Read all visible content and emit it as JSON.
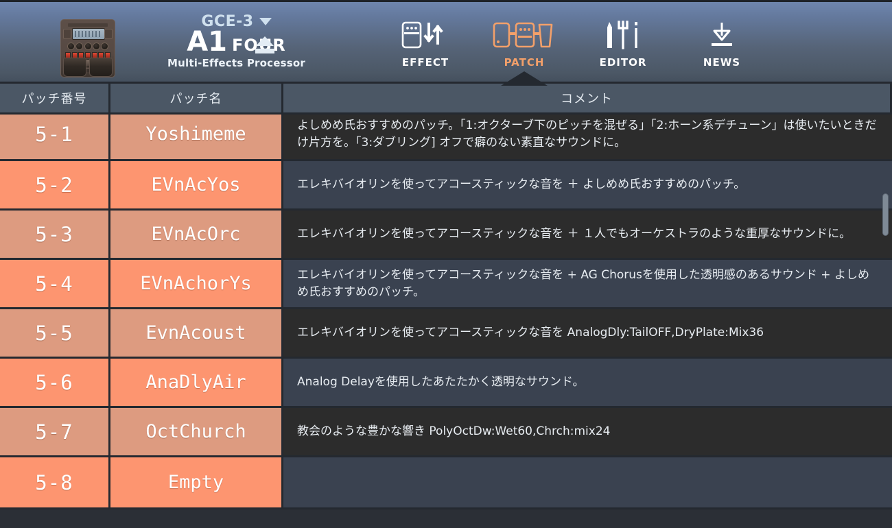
{
  "header": {
    "device_thumbnail_name": "multi-effects-pedal-thumbnail",
    "model_series": "GCE-3",
    "model_name": "A1",
    "model_suffix": "FOUR",
    "model_subtitle": "Multi-Effects Processor",
    "eject_icon": "eject-icon",
    "nav": [
      {
        "label": "EFFECT",
        "icon": "effect-pedal-transfer-icon",
        "active": false
      },
      {
        "label": "PATCH",
        "icon": "patch-chain-icon",
        "active": true
      },
      {
        "label": "EDITOR",
        "icon": "tools-icon",
        "active": false
      },
      {
        "label": "NEWS",
        "icon": "download-arrow-icon",
        "active": false
      }
    ]
  },
  "table": {
    "columns": {
      "number": "パッチ番号",
      "name": "パッチ名",
      "comment": "コメント"
    },
    "rows": [
      {
        "number": "5-1",
        "name": "Yoshimeme",
        "comment": "よしめめ氏おすすめのパッチ。「1:オクターブ下のピッチを混ぜる」「2:ホーン系デチューン」は使いたいときだけ片方を。「3:ダブリング] オフで癖のない素直なサウンドに。"
      },
      {
        "number": "5-2",
        "name": "EVnAcYos",
        "comment": "エレキバイオリンを使ってアコースティックな音を ＋ よしめめ氏おすすめのパッチ。"
      },
      {
        "number": "5-3",
        "name": "EVnAcOrc",
        "comment": "エレキバイオリンを使ってアコースティックな音を ＋ １人でもオーケストラのような重厚なサウンドに。"
      },
      {
        "number": "5-4",
        "name": "EVnAchorYs",
        "comment": "エレキバイオリンを使ってアコースティックな音を + AG Chorusを使用した透明感のあるサウンド + よしめめ氏おすすめのパッチ。"
      },
      {
        "number": "5-5",
        "name": "EvnAcoust",
        "comment": "エレキバイオリンを使ってアコースティックな音を AnalogDly:TailOFF,DryPlate:Mix36"
      },
      {
        "number": "5-6",
        "name": "AnaDlyAir",
        "comment": "Analog Delayを使用したあたたかく透明なサウンド。"
      },
      {
        "number": "5-7",
        "name": "OctChurch",
        "comment": "教会のような豊かな響き PolyOctDw:Wet60,Chrch:mix24"
      },
      {
        "number": "5-8",
        "name": "Empty",
        "comment": ""
      }
    ]
  },
  "colors": {
    "row_odd_patch": "#dd9b80",
    "row_even_patch": "#fd9570",
    "row_odd_comment": "#2c2c2c",
    "row_even_comment": "#3a4250",
    "accent": "#f3a06a",
    "header_top": "#6f86ad",
    "header_bottom": "#434e5c"
  },
  "scrollbar": {
    "name": "vertical-scrollbar"
  }
}
